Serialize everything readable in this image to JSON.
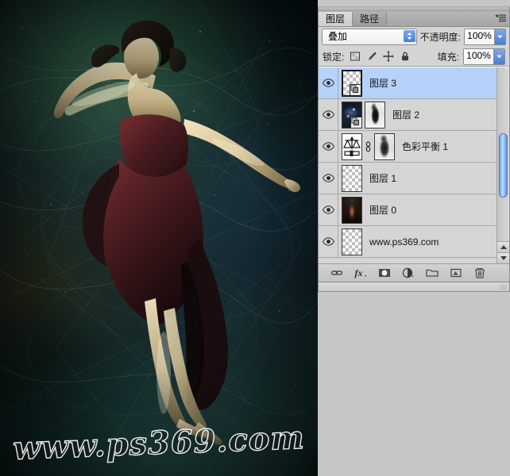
{
  "app": {
    "panel_title": "图层"
  },
  "panel": {
    "tabs": [
      {
        "label": "图层",
        "active": true
      },
      {
        "label": "路径",
        "active": false
      }
    ],
    "menu_icon": "panel-menu-icon",
    "blend_mode": {
      "label": "",
      "value": "叠加"
    },
    "opacity": {
      "label": "不透明度:",
      "value": "100%"
    },
    "lock": {
      "label": "锁定:",
      "icons": [
        "lock-transparent-pixels-icon",
        "lock-image-pixels-icon",
        "lock-position-icon",
        "lock-all-icon"
      ]
    },
    "fill": {
      "label": "填充:",
      "value": "100%"
    },
    "layers": [
      {
        "name": "图层 3",
        "visible": true,
        "selected": true,
        "thumb": "transparent",
        "has_clip_badge": true,
        "has_mask": false,
        "mask_type": "",
        "linked": false
      },
      {
        "name": "图层 2",
        "visible": true,
        "selected": false,
        "thumb": "space",
        "has_clip_badge": true,
        "has_mask": true,
        "mask_type": "hard",
        "linked": false
      },
      {
        "name": "色彩平衡 1",
        "visible": true,
        "selected": false,
        "thumb": "adjustment-color-balance",
        "has_clip_badge": false,
        "has_mask": true,
        "mask_type": "soft",
        "linked": true
      },
      {
        "name": "图层 1",
        "visible": true,
        "selected": false,
        "thumb": "transparent",
        "has_clip_badge": false,
        "has_mask": false,
        "mask_type": "",
        "linked": false
      },
      {
        "name": "图层 0",
        "visible": true,
        "selected": false,
        "thumb": "dancer",
        "has_clip_badge": false,
        "has_mask": false,
        "mask_type": "",
        "linked": false
      },
      {
        "name": "www.ps369.com",
        "visible": true,
        "selected": false,
        "thumb": "transparent",
        "has_clip_badge": false,
        "has_mask": false,
        "mask_type": "",
        "linked": false
      }
    ],
    "bottom_tools": [
      "link-layers-icon",
      "layer-style-fx-icon",
      "add-layer-mask-icon",
      "new-adjustment-layer-icon",
      "new-group-folder-icon",
      "new-layer-icon",
      "delete-layer-trash-icon"
    ],
    "scrollbar": {
      "up_arrow": "scroll-up-arrow-icon",
      "down_arrow": "scroll-down-arrow-icon"
    }
  },
  "canvas": {
    "watermark": "www.ps369.com"
  },
  "colors": {
    "panel_bg": "#d4d4d4",
    "row_bg": "#d5d5d5",
    "row_selected_bg": "#b6d2fb",
    "accent_blue": "#4a7fd0",
    "scrollbar_thumb": "#6aa4e8",
    "canvas_dark": "#071317",
    "canvas_teal": "#16302c"
  }
}
